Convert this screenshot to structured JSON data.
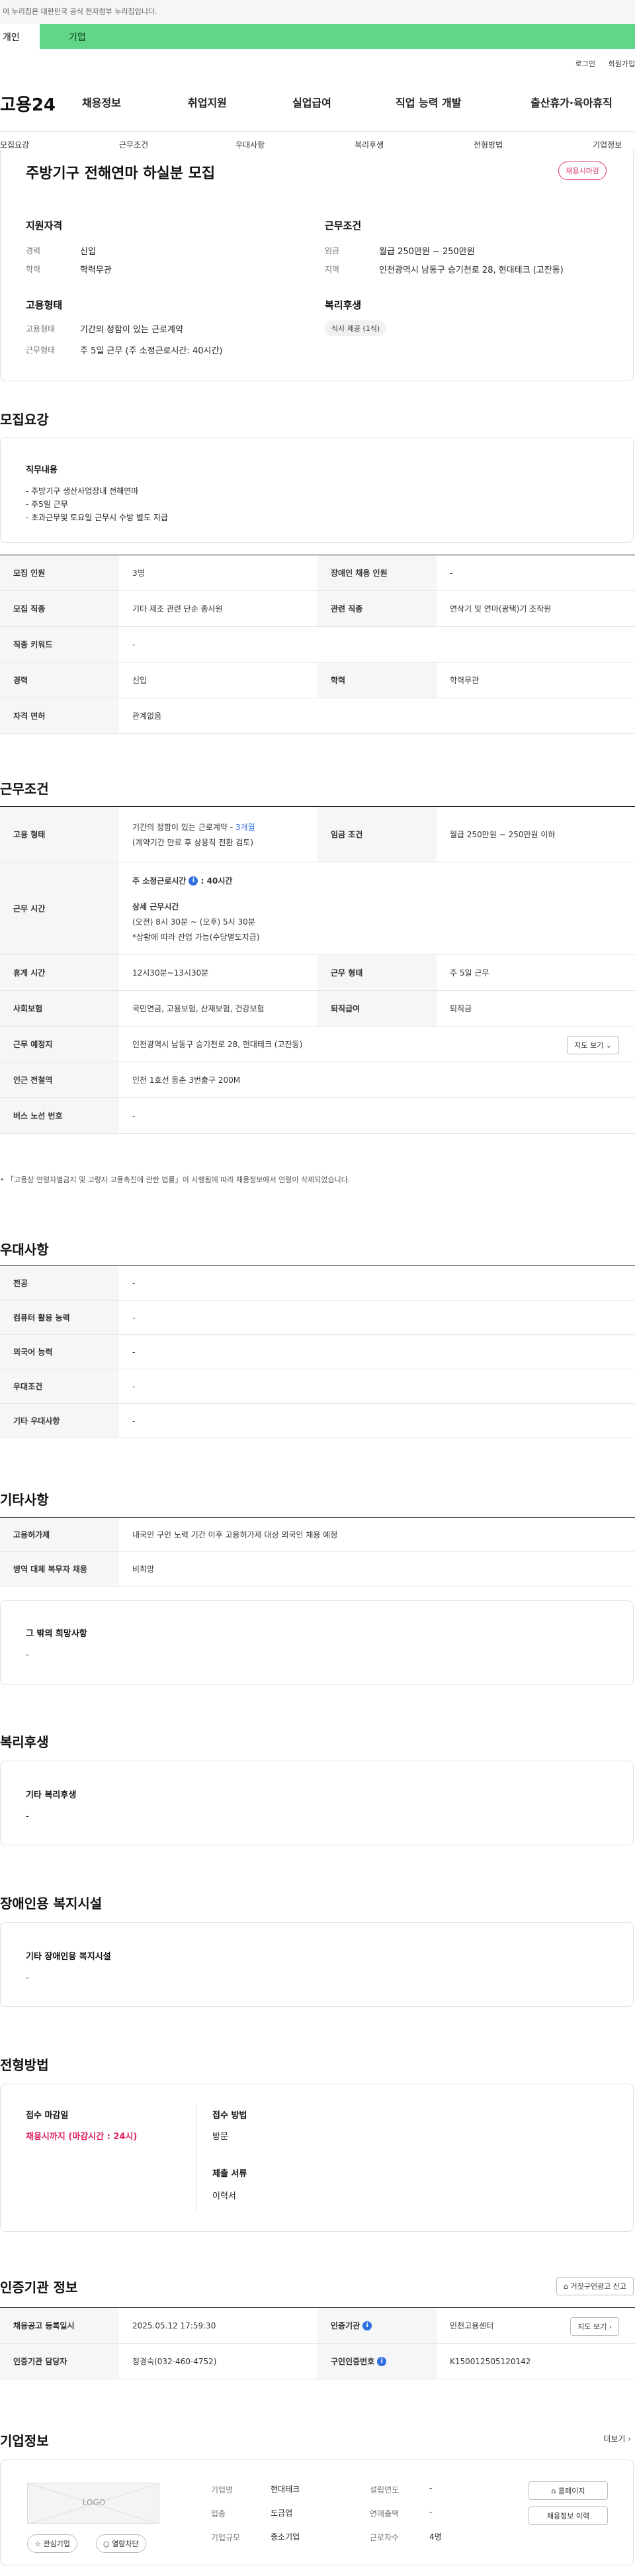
{
  "gov_banner": "이 누리집은 대한민국 공식 전자정부 누리집입니다.",
  "tabs": {
    "personal": "개인",
    "company": "기업"
  },
  "top_links": {
    "login": "로그인",
    "join": "회원가입"
  },
  "logo": "고용24",
  "gnb": [
    "채용정보",
    "취업지원",
    "실업급여",
    "직업 능력 개발",
    "출산휴가·육아휴직"
  ],
  "subnav": [
    "모집요강",
    "근무조건",
    "우대사항",
    "복리후생",
    "전형방법",
    "기업정보"
  ],
  "summary": {
    "title": "주방기구 전해연마 하실분 모집",
    "status": "채용시마감",
    "qual_heading": "지원자격",
    "qual": [
      {
        "label": "경력",
        "value": "신입"
      },
      {
        "label": "학력",
        "value": "학력무관"
      }
    ],
    "work_heading": "근무조건",
    "work": [
      {
        "label": "임금",
        "value": "월급 250만원 ~ 250만원"
      },
      {
        "label": "지역",
        "value": "인천광역시 남동구 승기천로 28, 현대테크 (고잔동)"
      }
    ],
    "emp_heading": "고용형태",
    "emp": [
      {
        "label": "고용형태",
        "value": "기간의 정함이 있는 근로계약"
      },
      {
        "label": "근무형태",
        "value": "주 5일 근무 (주 소정근로시간: 40시간)"
      }
    ],
    "welfare_heading": "복리후생",
    "welfare_chip": "식사 제공 (1식)"
  },
  "recruit": {
    "title": "모집요강",
    "duty_heading": "직무내용",
    "duty_lines": [
      "- 주방기구 생산사업장내 전해연마",
      "- 주5일 근무",
      "- 초과근무및 토요일 근무시 수방 별도 지급"
    ],
    "rows": [
      {
        "th1": "모집 인원",
        "td1": "3명",
        "th2": "장애인 채용 인원",
        "td2": "-"
      },
      {
        "th1": "모집 직종",
        "td1": "기타 제조 관련 단순 종사원",
        "th2": "관련 직종",
        "td2": "연삭기 및 연마(광택)기 조작원"
      },
      {
        "th1": "직종 키워드",
        "td1": "-"
      },
      {
        "th1": "경력",
        "td1": "신입",
        "th2": "학력",
        "td2": "학력무관"
      },
      {
        "th1": "자격 면허",
        "td1": "관계없음"
      }
    ]
  },
  "work": {
    "title": "근무조건",
    "emp_th": "고용 형태",
    "emp_value": "기간의 정함이 있는 근로계약 - ",
    "emp_period": "3개월",
    "emp_sub": "(계약기간 만료 후 상용직 전환 검토)",
    "wage_th": "임금 조건",
    "wage_value": "월급 250만원 ~ 250만원 이하",
    "hours_th": "근무 시간",
    "hours_weekly": "주 소정근로시간",
    "hours_weekly_value": ": 40시간",
    "hours_detail_title": "상세 근무시간",
    "hours_detail": "(오전) 8시 30분 ~ (오후) 5시 30분",
    "hours_note": "*상황에 따라 잔업 가능(수당별도지급)",
    "info_glyph": "i",
    "rows": [
      {
        "th1": "휴게 시간",
        "td1": "12시30분~13시30분",
        "th2": "근무 형태",
        "td2": "주 5일 근무"
      },
      {
        "th1": "사회보험",
        "td1": "국민연금, 고용보험, 산재보험, 건강보험",
        "th2": "퇴직급여",
        "td2": "퇴직금"
      }
    ],
    "place_th": "근무 예정지",
    "place_value": "인천광역시 남동구 승기천로 28, 현대테크 (고잔동)",
    "map_btn": "지도 보기",
    "subway_th": "인근 전철역",
    "subway_value": "인천 1호선 동춘 3번출구 200M",
    "bus_th": "버스 노선 번호",
    "bus_value": "-",
    "legal_note": "「고용상 연령차별금지 및 고령자 고용촉진에 관한 법률」이 시행됨에 따라 채용정보에서 연령이 삭제되었습니다."
  },
  "pref": {
    "title": "우대사항",
    "rows": [
      {
        "th": "전공",
        "td": "-"
      },
      {
        "th": "컴퓨터 활용 능력",
        "td": "-"
      },
      {
        "th": "외국어 능력",
        "td": "-"
      },
      {
        "th": "우대조건",
        "td": "-"
      },
      {
        "th": "기타 우대사항",
        "td": "-"
      }
    ]
  },
  "etc": {
    "title": "기타사항",
    "rows": [
      {
        "th": "고용허가제",
        "td": "내국인 구인 노력 기간 이후 고용허가제 대상 외국인 채용 예정"
      },
      {
        "th": "병역 대체 복무자 채용",
        "td": "비희망"
      }
    ],
    "box_title": "그 밖의 희망사항",
    "box_value": "-"
  },
  "welfare": {
    "title": "복리후생",
    "box_title": "기타 복리후생",
    "box_value": "-"
  },
  "disabled": {
    "title": "장애인용 복지시설",
    "box_title": "기타 장애인용 복지시설",
    "box_value": "-"
  },
  "selection": {
    "title": "전형방법",
    "deadline_label": "접수 마감일",
    "deadline_value": "채용시까지 (마감시간 : 24시)",
    "method_label": "접수 방법",
    "method_value": "방문",
    "docs_label": "제출 서류",
    "docs_value": "이력서"
  },
  "cert": {
    "title": "인증기관 정보",
    "report_btn": "거짓구인광고 신고",
    "rows": [
      {
        "th1": "채용공고 등록일시",
        "td1": "2025.05.12 17:59:30",
        "th2": "인증기관",
        "td2": "인천고용센터"
      },
      {
        "th1": "인증기관 담당자",
        "td1": "정경숙(032-460-4752)",
        "th2": "구인인증번호",
        "td2": "K150012505120142"
      }
    ],
    "map_btn": "지도 보기"
  },
  "company": {
    "title": "기업정보",
    "more": "더보기",
    "logo_placeholder": "LOGO",
    "fav_btn": "관심기업",
    "block_btn": "열람차단",
    "fields": [
      {
        "label": "기업명",
        "value": "현대테크"
      },
      {
        "label": "업종",
        "value": "도금업"
      },
      {
        "label": "기업규모",
        "value": "중소기업"
      },
      {
        "label": "설립연도",
        "value": "-"
      },
      {
        "label": "연매출액",
        "value": "-"
      },
      {
        "label": "근로자수",
        "value": "4명"
      }
    ],
    "homepage_btn": "홈페이지",
    "history_btn": "채용정보 이력"
  }
}
